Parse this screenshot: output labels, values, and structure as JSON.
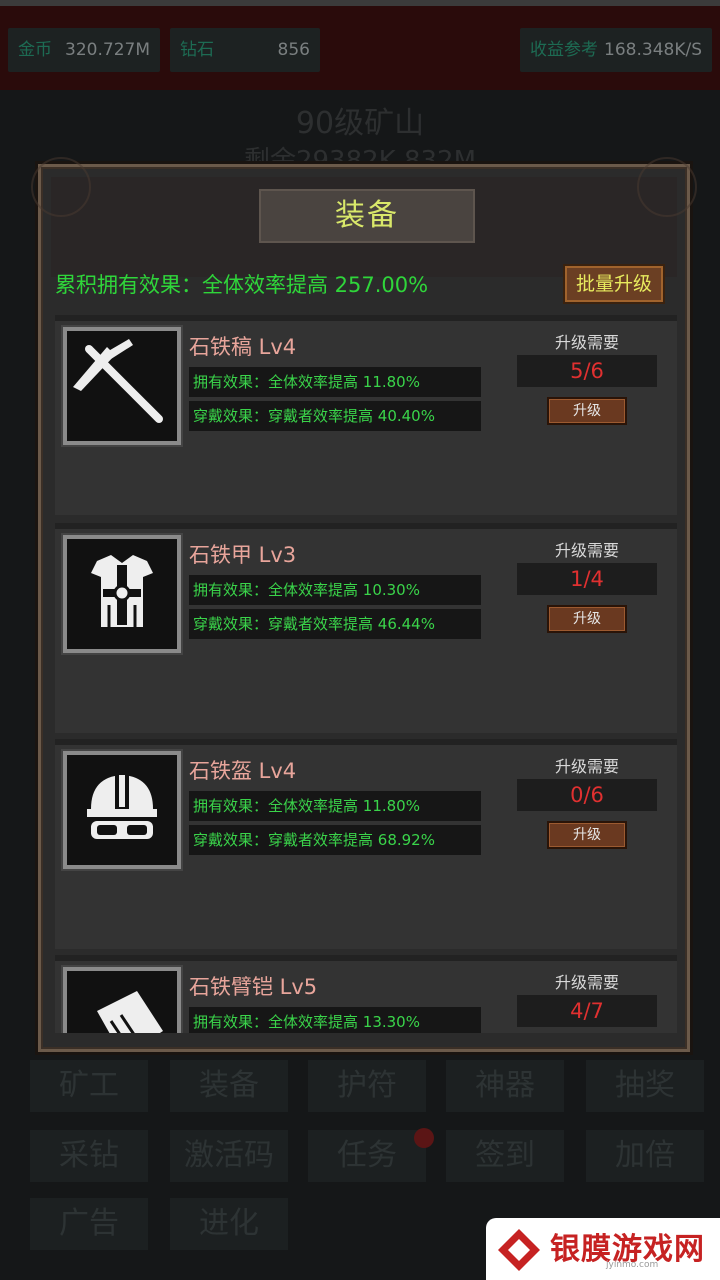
{
  "topbar": {
    "gold_label": "金币",
    "gold_value": "320.727M",
    "diamond_label": "钻石",
    "diamond_value": "856",
    "income_label": "收益参考",
    "income_value": "168.348K/S"
  },
  "background": {
    "mine_title": "90级矿山",
    "remaining": "剩余29382K 832M"
  },
  "modal": {
    "title": "装备",
    "cumulative_effect": "累积拥有效果：全体效率提高 257.00%",
    "batch_upgrade": "批量升级",
    "items": [
      {
        "name": "石铁稿 Lv4",
        "own_effect": "拥有效果：全体效率提高 11.80%",
        "wear_effect": "穿戴效果：穿戴者效率提高 40.40%",
        "req_label": "升级需要",
        "req_count": "5/6",
        "upgrade": "升级",
        "icon": "pickaxe-icon"
      },
      {
        "name": "石铁甲 Lv3",
        "own_effect": "拥有效果：全体效率提高 10.30%",
        "wear_effect": "穿戴效果：穿戴者效率提高 46.44%",
        "req_label": "升级需要",
        "req_count": "1/4",
        "upgrade": "升级",
        "icon": "armor-icon"
      },
      {
        "name": "石铁盔 Lv4",
        "own_effect": "拥有效果：全体效率提高 11.80%",
        "wear_effect": "穿戴效果：穿戴者效率提高 68.92%",
        "req_label": "升级需要",
        "req_count": "0/6",
        "upgrade": "升级",
        "icon": "helmet-icon"
      },
      {
        "name": "石铁臂铠 Lv5",
        "own_effect": "拥有效果：全体效率提高 13.30%",
        "wear_effect": "",
        "req_label": "升级需要",
        "req_count": "4/7",
        "upgrade": "",
        "icon": "bracer-icon"
      }
    ]
  },
  "bottom_nav": {
    "miner": "矿工",
    "equipment": "装备",
    "amulet": "护符",
    "artifact": "神器",
    "lottery": "抽奖",
    "mining": "采钻",
    "activation_code": "激活码",
    "task": "任务",
    "checkin": "签到",
    "double": "加倍",
    "ad": "广告",
    "evolve": "进化"
  },
  "watermark": {
    "text": "银膜游戏网",
    "sub": "jyinmo.com"
  },
  "colors": {
    "accent_green": "#2fd63a",
    "count_red": "#e03030",
    "title_yellow": "#d9e86a",
    "name_pink": "#e8a59b"
  }
}
